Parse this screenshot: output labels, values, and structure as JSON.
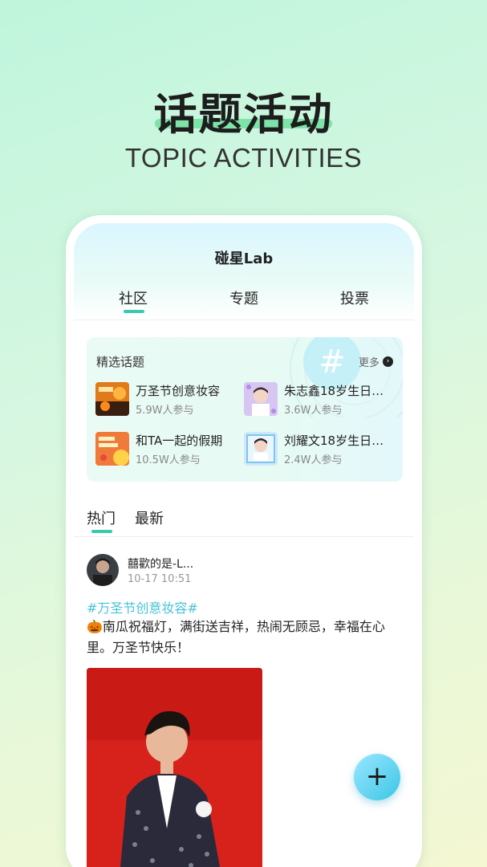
{
  "hero": {
    "title": "话题活动",
    "subtitle": "TOPIC ACTIVITIES"
  },
  "app": {
    "title": "碰星Lab"
  },
  "tabs": [
    {
      "label": "社区",
      "active": true
    },
    {
      "label": "专题",
      "active": false
    },
    {
      "label": "投票",
      "active": false
    }
  ],
  "featured": {
    "title": "精选话题",
    "more_label": "更多",
    "topics": [
      {
        "name": "万圣节创意妆容",
        "count": "5.9W人参与",
        "icon": "halloween-thumbnail"
      },
      {
        "name": "朱志鑫18岁生日…",
        "count": "3.6W人参与",
        "icon": "birthday-thumbnail"
      },
      {
        "name": "和TA一起的假期",
        "count": "10.5W人参与",
        "icon": "holiday-thumbnail"
      },
      {
        "name": "刘耀文18岁生日…",
        "count": "2.4W人参与",
        "icon": "birthday-thumbnail"
      }
    ]
  },
  "feed_tabs": [
    {
      "label": "热门",
      "active": true
    },
    {
      "label": "最新",
      "active": false
    }
  ],
  "post": {
    "user": "囍歡的是-L...",
    "time": "10-17 10:51",
    "tag": "#万圣节创意妆容#",
    "text": "🎃南瓜祝福灯，满街送吉祥，热闹无顾忌，幸福在心里。万圣节快乐！"
  },
  "fab": {
    "icon": "plus-icon",
    "symbol": "+"
  },
  "colors": {
    "accent": "#3cc8b0",
    "tag": "#47c3d6",
    "fab": "#3cc6e6"
  }
}
